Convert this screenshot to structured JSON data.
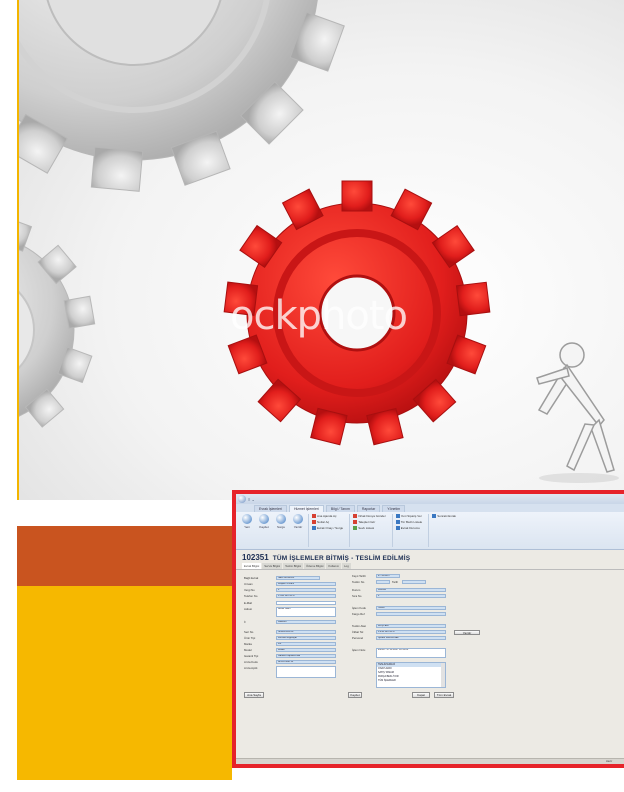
{
  "watermark": {
    "text": "ockphoto"
  },
  "window": {
    "qat": "≡ ⌄",
    "ribbon_tabs": [
      "Evrak İşlemleri",
      "Hizmet İşlemleri",
      "Bilgi / Tanım",
      "Raporlar",
      "Yönetim"
    ],
    "ribbon_buttons": [
      "Yeni",
      "Kaydet",
      "Sorgu",
      "Yazdır"
    ],
    "ribbon_small_a": [
      "Ana Ajanda Aç",
      "Notlar Aç",
      "Evrak Onay / Sorgu"
    ],
    "ribbon_small_b": [
      "Ortak Dosya Gönder",
      "Talepleri Gör",
      "Sevk Listesi"
    ],
    "ribbon_small_c": [
      "Yeni Sipariş Ver",
      "Tür Bazlı Listele",
      "Evrak Durumu"
    ],
    "ribbon_small_d": [
      "Sonraki Evrak"
    ],
    "doc_no": "102351",
    "doc_title": "TÜM İŞLEMLER BİTMİŞ - TESLİM EDİLMİŞ",
    "subtabs": [
      "Evrak Bilgisi",
      "Servis Bilgisi",
      "Teslim Bilgisi",
      "Ödeme Bilgisi",
      "Kullanıcı",
      "Log"
    ],
    "left_labels": [
      "Bağlı Evrak",
      "Unvanı",
      "Vergi No",
      "Telefon No",
      "E-Mail",
      "Adresi",
      "İl",
      "Seri No",
      "Ürün Tipi",
      "Marka",
      "Model",
      "Garanti Tipi",
      "Arıza Kodu",
      "Arıza Açıkl."
    ],
    "left_values": [
      "SER 00014953",
      "Müşteri Unvanı",
      "1",
      "0 532 123 45 67",
      "",
      "Adres Satırı",
      "İstanbul",
      "SN001456789",
      "Dizüstü Bilgisayar",
      "LG",
      "Model",
      "Garanti Kapsamında",
      "Arıza Kodu 14",
      ""
    ],
    "right_labels": [
      "Kayıt Tarihi",
      "Teslim No",
      "Durum",
      "Sıra No",
      "İşlem Kodu",
      "Kargo Ref",
      "Teslim Alan",
      "İrtibat Tel",
      "Personel",
      "İşlem Notu"
    ],
    "right_values": [
      "27.11.2007",
      "",
      "KAPALI",
      "1",
      "Teslim",
      "",
      "MÜŞTERİ",
      "0 212 123 45 67",
      "İŞLEM PERSONEL",
      "26/06/.. 27.11.2007 10:11:00"
    ],
    "tarih_label": "Tarih",
    "list_rows": [
      "TESLİM EDİLDİ",
      "ONAYLANDI",
      "SATIŞ TAMAM",
      "PARÇA BEKLİYOR",
      "TÜM İŞLEMLER"
    ],
    "side_btn": "Yazdır",
    "bottom_left_btn": "Ana Sayfa",
    "bottom_mid_btn": "Kaydet",
    "bottom_mid2": "Kapat",
    "bottom_right_btn": "Tüm Evrak",
    "status": "Hazır"
  }
}
